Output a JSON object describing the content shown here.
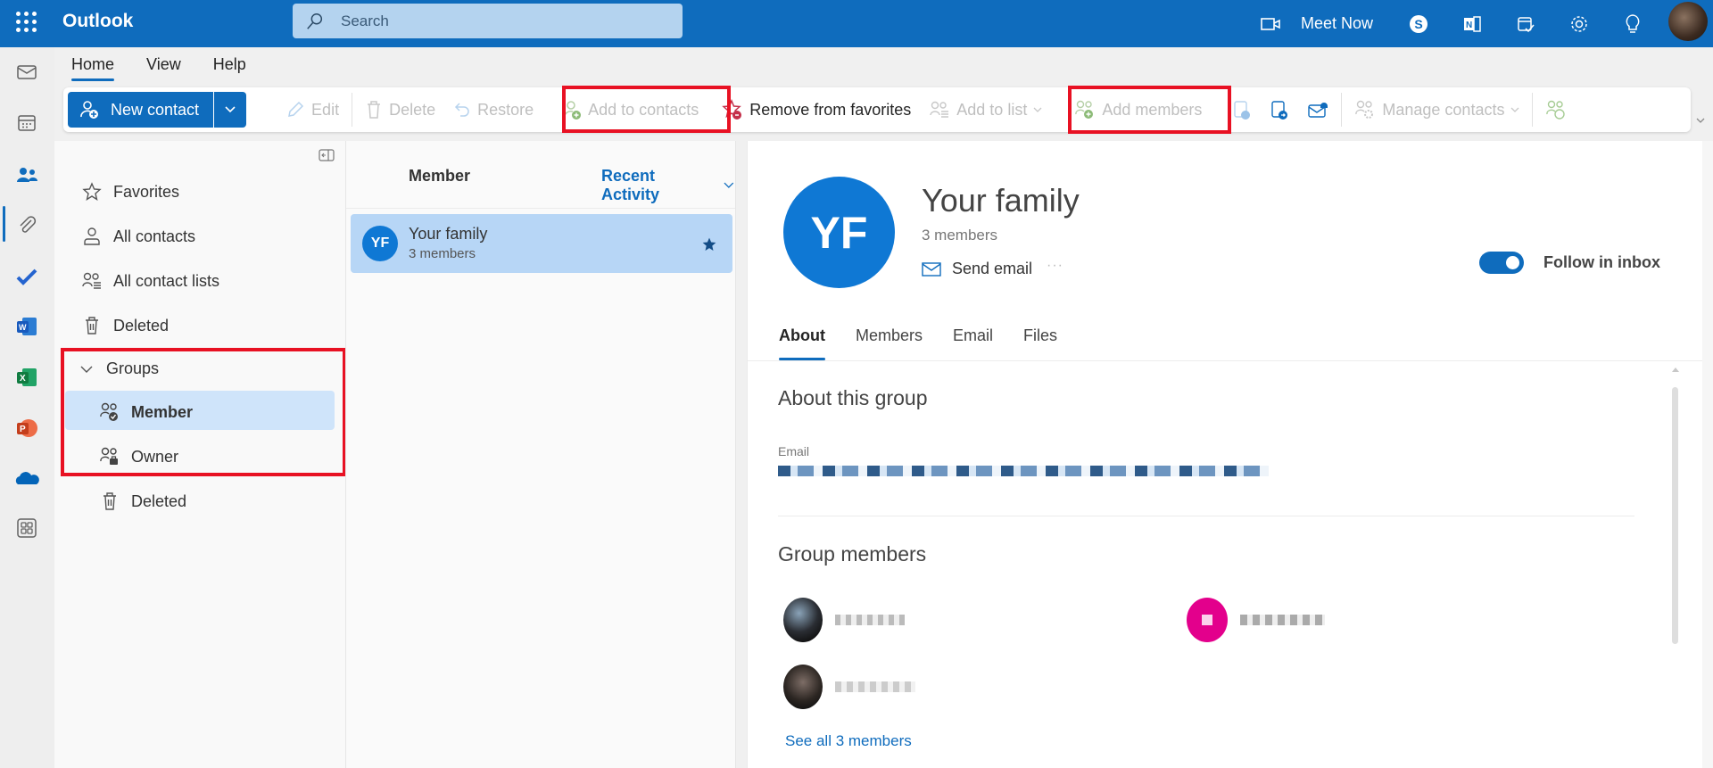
{
  "header": {
    "app_name": "Outlook",
    "search_placeholder": "Search",
    "meet_now_label": "Meet Now",
    "icons": [
      "app-launcher-icon",
      "video-camera-icon",
      "skype-icon",
      "onenote-icon",
      "calendar-check-icon",
      "settings-gear-icon",
      "lightbulb-icon",
      "profile-avatar"
    ]
  },
  "rail": {
    "items": [
      "mail",
      "calendar",
      "people",
      "files",
      "todo",
      "word",
      "excel",
      "powerpoint",
      "onedrive",
      "more-apps"
    ],
    "active": "people"
  },
  "ribbon": {
    "tabs": [
      {
        "label": "Home",
        "active": true
      },
      {
        "label": "View",
        "active": false
      },
      {
        "label": "Help",
        "active": false
      }
    ],
    "new_contact_label": "New contact",
    "buttons": {
      "edit": "Edit",
      "delete": "Delete",
      "restore": "Restore",
      "add_to_contacts": "Add to contacts",
      "remove_from_favorites": "Remove from favorites",
      "add_to_list": "Add to list",
      "add_members": "Add members",
      "manage_contacts": "Manage contacts"
    }
  },
  "nav": {
    "favorites": "Favorites",
    "all_contacts": "All contacts",
    "all_contact_lists": "All contact lists",
    "deleted": "Deleted",
    "groups": "Groups",
    "member": "Member",
    "owner": "Owner",
    "groups_deleted": "Deleted"
  },
  "list": {
    "title": "Member",
    "sort_label": "Recent Activity",
    "items": [
      {
        "initials": "YF",
        "name": "Your family",
        "subtitle": "3 members",
        "favorite": true
      }
    ]
  },
  "detail": {
    "initials": "YF",
    "name": "Your family",
    "member_count": "3 members",
    "send_email": "Send email",
    "more": "···",
    "follow_label": "Follow in inbox",
    "follow_on": true,
    "tabs": [
      {
        "label": "About",
        "active": true
      },
      {
        "label": "Members"
      },
      {
        "label": "Email"
      },
      {
        "label": "Files"
      }
    ],
    "about_heading": "About this group",
    "email_label": "Email",
    "email_value": "[redacted]",
    "members_heading": "Group members",
    "see_all": "See all 3 members",
    "members": [
      {
        "name": "[redacted]"
      },
      {
        "name": "[redacted]"
      },
      {
        "name": "[redacted]"
      }
    ]
  },
  "colors": {
    "brand": "#0f6cbd",
    "selected": "#cfe4fa",
    "highlight_box": "#e81123",
    "avatar_blue": "#0f78d4",
    "member_pink": "#e3008c"
  }
}
